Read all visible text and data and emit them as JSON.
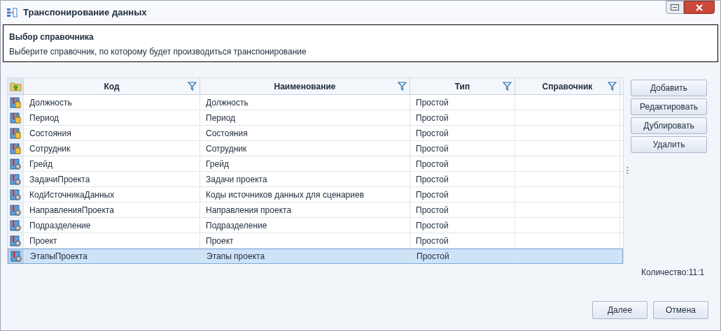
{
  "window": {
    "title": "Транспонирование данных"
  },
  "header": {
    "title": "Выбор справочника",
    "description": "Выберите справочник, по которому будет производиться транспонирование"
  },
  "table": {
    "columns": [
      "Код",
      "Наименование",
      "Тип",
      "Справочник"
    ],
    "rows": [
      {
        "kind": "lock",
        "code": "Должность",
        "name": "Должность",
        "type": "Простой",
        "selected": false
      },
      {
        "kind": "lock",
        "code": "Период",
        "name": "Период",
        "type": "Простой",
        "selected": false
      },
      {
        "kind": "lock",
        "code": "Состояния",
        "name": "Состояния",
        "type": "Простой",
        "selected": false
      },
      {
        "kind": "lock",
        "code": "Сотрудник",
        "name": "Сотрудник",
        "type": "Простой",
        "selected": false
      },
      {
        "kind": "gear",
        "code": "Грейд",
        "name": "Грейд",
        "type": "Простой",
        "selected": false
      },
      {
        "kind": "gear",
        "code": "ЗадачиПроекта",
        "name": "Задачи проекта",
        "type": "Простой",
        "selected": false
      },
      {
        "kind": "gear",
        "code": "КодИсточникаДанных",
        "name": "Коды источников данных для сценариев",
        "type": "Простой",
        "selected": false
      },
      {
        "kind": "gear",
        "code": "НаправленияПроекта",
        "name": "Направления проекта",
        "type": "Простой",
        "selected": false
      },
      {
        "kind": "gear",
        "code": "Подразделение",
        "name": "Подразделение",
        "type": "Простой",
        "selected": false
      },
      {
        "kind": "gear",
        "code": "Проект",
        "name": "Проект",
        "type": "Простой",
        "selected": false
      },
      {
        "kind": "gear",
        "code": "ЭтапыПроекта",
        "name": "Этапы проекта",
        "type": "Простой",
        "selected": true
      }
    ]
  },
  "side_buttons": [
    "Добавить",
    "Редактировать",
    "Дублировать",
    "Удалить"
  ],
  "count": "Количество:11:1",
  "footer_buttons": [
    "Далее",
    "Отмена"
  ]
}
